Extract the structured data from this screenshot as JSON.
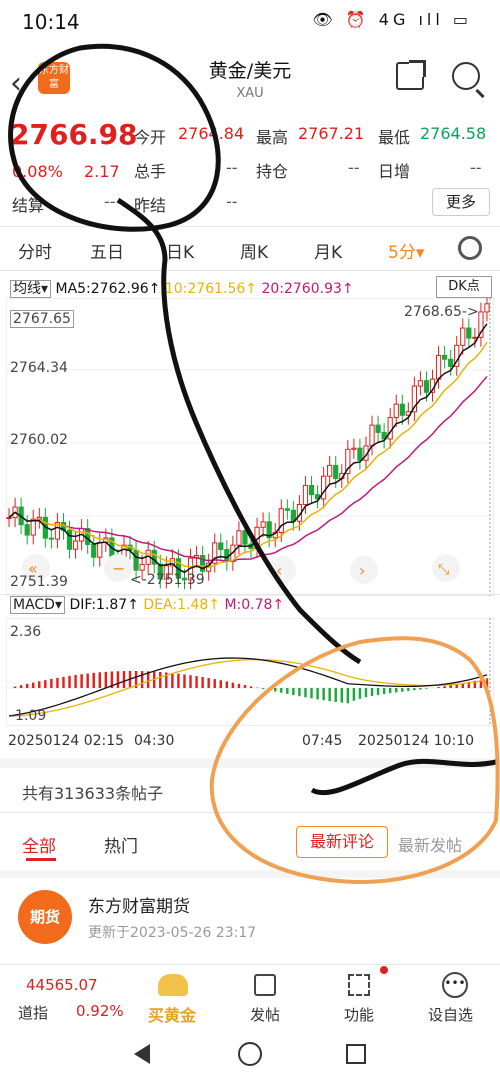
{
  "status_bar": {
    "time": "10:14",
    "icons_text": "👁 ⏰ 4G ıll ▭"
  },
  "header": {
    "logo_text": "东方财富",
    "title": "黄金/美元",
    "subtitle": "XAU"
  },
  "quote": {
    "price": "2766.98",
    "change_pct": "0.08%",
    "change_abs": "2.17",
    "today_open_label": "今开",
    "today_open": "2764.84",
    "high_label": "最高",
    "high": "2767.21",
    "low_label": "最低",
    "low": "2764.58",
    "volume_label": "总手",
    "volume": "--",
    "position_label": "持仓",
    "position": "--",
    "daily_inc_label": "日增",
    "daily_inc": "--",
    "settle_label": "结算",
    "settle": "--",
    "prev_settle_label": "昨结",
    "prev_settle": "--",
    "more_label": "更多"
  },
  "tabs": [
    "分时",
    "五日",
    "日K",
    "周K",
    "月K",
    "5分▾"
  ],
  "kline": {
    "ma_select": "均线▾",
    "ma5": "MA5:2762.96↑",
    "ma10": "10:2761.56↑",
    "ma20": "20:2760.93↑",
    "dk_label": "DK点",
    "y_labels": [
      "2767.65",
      "2764.34",
      "2760.02",
      "2751.39"
    ],
    "last_label": "2768.65->",
    "low_label": "<-2751.39",
    "colors": {
      "ma5": "#111111",
      "ma10": "#e8b400",
      "ma20": "#c2187d",
      "up": "#e0201d",
      "down": "#1aa83a"
    }
  },
  "macd": {
    "select": "MACD▾",
    "dif": "DIF:1.87↑",
    "dea": "DEA:1.48↑",
    "m": "M:0.78↑",
    "y_top": "2.36",
    "y_bottom": "-1.09"
  },
  "x_axis": {
    "left": "20250124 02:15",
    "mid": "04:30",
    "mid2": "07:45",
    "right": "20250124 10:10"
  },
  "posts": {
    "count_text": "共有313633条帖子",
    "filter_all": "全部",
    "filter_hot": "热门",
    "sort_latest_comment": "最新评论",
    "sort_latest_post": "最新发帖"
  },
  "feed": {
    "logo_text": "期货",
    "name": "东方财富期货",
    "time": "更新于2023-05-26 23:17"
  },
  "bottom_bar": {
    "index_value": "44565.07",
    "index_label": "道指",
    "index_pct": "0.92%",
    "buy_gold": "买黄金",
    "post": "发帖",
    "function": "功能",
    "watchlist": "设自选"
  }
}
